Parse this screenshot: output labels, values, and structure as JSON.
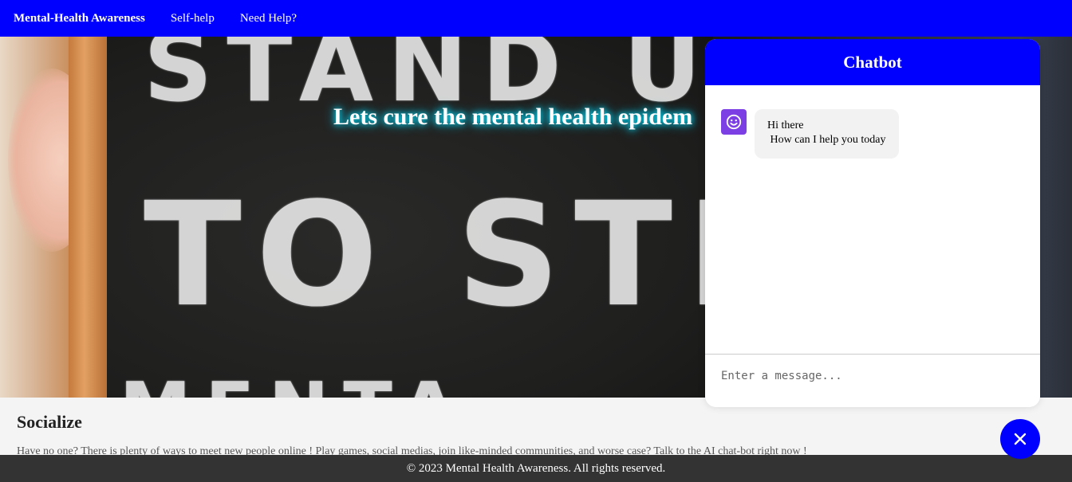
{
  "navbar": {
    "brand": "Mental-Health Awareness",
    "links": [
      "Self-help",
      "Need Help?"
    ]
  },
  "hero": {
    "headline": "Lets cure the mental health epidem",
    "chalk_lines": [
      "STAND U",
      "TO STIGM",
      "MENTA"
    ]
  },
  "section": {
    "title": "Socialize",
    "text": "Have no one? There is plenty of ways to meet new people online ! Play games, social medias, join like-minded communities, and worse case? Talk to the AI chat-bot right now !"
  },
  "footer": {
    "text": "© 2023 Mental Health Awareness. All rights reserved."
  },
  "chatbot": {
    "title": "Chatbot",
    "bot_icon": "smiley-icon",
    "messages": [
      {
        "from": "bot",
        "text": "Hi there\n How can I help you today"
      }
    ],
    "input_placeholder": "Enter a message...",
    "close_icon": "close-icon"
  },
  "colors": {
    "primary": "#0000ff",
    "avatar": "#7b3fe4",
    "footer_bg": "#333333",
    "glow": "#00e5ff"
  }
}
